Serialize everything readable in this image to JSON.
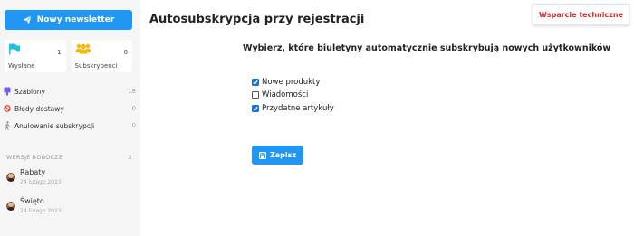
{
  "sidebar": {
    "new_newsletter_label": "Nowy newsletter",
    "stats": [
      {
        "label": "Wysłane",
        "count": "1",
        "icon": "flag-icon"
      },
      {
        "label": "Subskrybenci",
        "count": "0",
        "icon": "users-icon"
      }
    ],
    "nav": [
      {
        "label": "Szablony",
        "count": "18",
        "icon": "template-icon"
      },
      {
        "label": "Błędy dostawy",
        "count": "0",
        "icon": "ban-icon"
      },
      {
        "label": "Anulowanie subskrypcji",
        "count": "0",
        "icon": "walking-icon"
      }
    ],
    "drafts_header": "WERSJE ROBOCZE",
    "drafts_count": "2",
    "drafts": [
      {
        "title": "Rabaty",
        "date": "24 lutego 2023"
      },
      {
        "title": "Święto",
        "date": "24 lutego 2023"
      }
    ]
  },
  "main": {
    "title": "Autosubskrypcja przy rejestracji",
    "subtitle": "Wybierz, które biuletyny automatycznie subskrybują nowych użytkowników",
    "options": [
      {
        "label": "Nowe produkty",
        "checked": true
      },
      {
        "label": "Wiadomości",
        "checked": false
      },
      {
        "label": "Przydatne artykuły",
        "checked": true
      }
    ],
    "save_label": "Zapisz"
  },
  "support_label": "Wsparcie techniczne",
  "colors": {
    "accent": "#2196f3",
    "checkbox": "#1976d2",
    "support_text": "#d32f2f",
    "flag": "#1ec0e6",
    "users": "#f5b70a",
    "template": "#7b5cf0",
    "ban": "#e53935"
  }
}
